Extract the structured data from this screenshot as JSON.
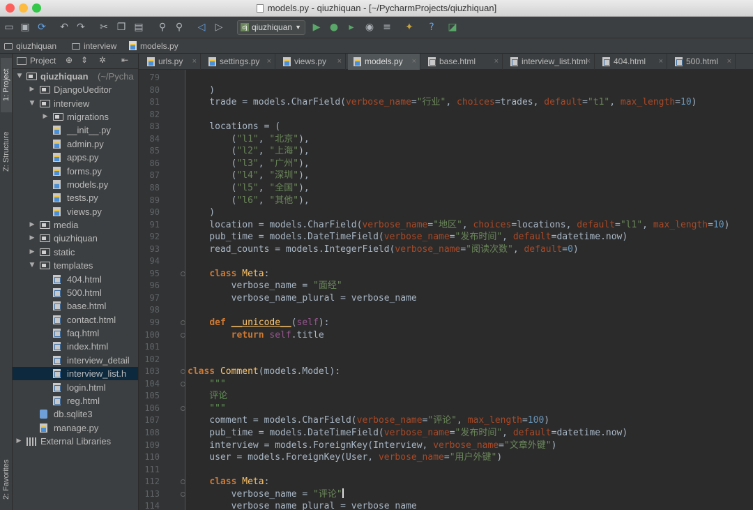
{
  "window": {
    "title": "models.py - qiuzhiquan - [~/PycharmProjects/qiuzhiquan]",
    "traffic_colors": [
      "#fc605c",
      "#fdbc40",
      "#34c84a"
    ]
  },
  "toolbar": {
    "run_config": "qiuzhiquan",
    "icons": [
      "open-folder-icon",
      "save-icon",
      "sync-icon",
      "back-icon",
      "forward-icon",
      "cut-icon",
      "copy-icon",
      "paste-icon",
      "find-icon",
      "replace-icon",
      "nav-back-icon",
      "nav-forward-icon",
      "run-icon",
      "debug-icon",
      "coverage-icon",
      "profile-icon",
      "tasks-icon",
      "settings-icon",
      "help-icon",
      "vcs-icon"
    ]
  },
  "navbar": {
    "crumbs": [
      "qiuzhiquan",
      "interview",
      "models.py"
    ]
  },
  "sidebar": {
    "tabs": [
      "1: Project",
      "Z: Structure",
      "2: Favorites"
    ]
  },
  "project": {
    "header_label": "Project",
    "root_name": "qiuzhiquan",
    "root_path": "(~/Pycha",
    "items": [
      {
        "label": "DjangoUeditor",
        "type": "folder"
      },
      {
        "label": "interview",
        "type": "folder"
      },
      {
        "label": "migrations",
        "type": "folder"
      },
      {
        "label": "__init__.py",
        "type": "py"
      },
      {
        "label": "admin.py",
        "type": "py"
      },
      {
        "label": "apps.py",
        "type": "py"
      },
      {
        "label": "forms.py",
        "type": "py"
      },
      {
        "label": "models.py",
        "type": "py"
      },
      {
        "label": "tests.py",
        "type": "py"
      },
      {
        "label": "views.py",
        "type": "py"
      },
      {
        "label": "media",
        "type": "folder"
      },
      {
        "label": "qiuzhiquan",
        "type": "folder"
      },
      {
        "label": "static",
        "type": "folder"
      },
      {
        "label": "templates",
        "type": "folder"
      },
      {
        "label": "404.html",
        "type": "html"
      },
      {
        "label": "500.html",
        "type": "html"
      },
      {
        "label": "base.html",
        "type": "html"
      },
      {
        "label": "contact.html",
        "type": "html"
      },
      {
        "label": "faq.html",
        "type": "html"
      },
      {
        "label": "index.html",
        "type": "html"
      },
      {
        "label": "interview_detail",
        "type": "html"
      },
      {
        "label": "interview_list.h",
        "type": "html",
        "selected": true
      },
      {
        "label": "login.html",
        "type": "html"
      },
      {
        "label": "reg.html",
        "type": "html"
      },
      {
        "label": "db.sqlite3",
        "type": "db"
      },
      {
        "label": "manage.py",
        "type": "py"
      },
      {
        "label": "External Libraries",
        "type": "lib"
      }
    ]
  },
  "tabs": [
    {
      "label": "urls.py",
      "type": "py"
    },
    {
      "label": "settings.py",
      "type": "py"
    },
    {
      "label": "views.py",
      "type": "py"
    },
    {
      "label": "models.py",
      "type": "py",
      "active": true
    },
    {
      "label": "base.html",
      "type": "html"
    },
    {
      "label": "interview_list.html",
      "type": "html"
    },
    {
      "label": "404.html",
      "type": "html"
    },
    {
      "label": "500.html",
      "type": "html"
    }
  ],
  "editor": {
    "lines": [
      {
        "n": "79",
        "tokens": []
      },
      {
        "n": "80",
        "tokens": [
          [
            "",
            "    )"
          ]
        ]
      },
      {
        "n": "81",
        "tokens": [
          [
            "",
            "    trade = models.CharField("
          ],
          [
            "pn",
            "verbose_name"
          ],
          [
            "",
            "="
          ],
          [
            "st",
            "\"行业\""
          ],
          [
            "",
            ", "
          ],
          [
            "pn",
            "choices"
          ],
          [
            "",
            "=trades, "
          ],
          [
            "pn",
            "default"
          ],
          [
            "",
            "="
          ],
          [
            "st",
            "\"t1\""
          ],
          [
            "",
            ", "
          ],
          [
            "pn",
            "max_length"
          ],
          [
            "",
            "="
          ],
          [
            "nm",
            "10"
          ],
          [
            "",
            ")"
          ]
        ]
      },
      {
        "n": "82",
        "tokens": []
      },
      {
        "n": "83",
        "tokens": [
          [
            "",
            "    locations = ("
          ]
        ]
      },
      {
        "n": "84",
        "tokens": [
          [
            "",
            "        ("
          ],
          [
            "st",
            "\"l1\""
          ],
          [
            "",
            ", "
          ],
          [
            "st",
            "\"北京\""
          ],
          [
            "",
            "),"
          ]
        ]
      },
      {
        "n": "85",
        "tokens": [
          [
            "",
            "        ("
          ],
          [
            "st",
            "\"l2\""
          ],
          [
            "",
            ", "
          ],
          [
            "st",
            "\"上海\""
          ],
          [
            "",
            "),"
          ]
        ]
      },
      {
        "n": "86",
        "tokens": [
          [
            "",
            "        ("
          ],
          [
            "st",
            "\"l3\""
          ],
          [
            "",
            ", "
          ],
          [
            "st",
            "\"广州\""
          ],
          [
            "",
            "),"
          ]
        ]
      },
      {
        "n": "87",
        "tokens": [
          [
            "",
            "        ("
          ],
          [
            "st",
            "\"l4\""
          ],
          [
            "",
            ", "
          ],
          [
            "st",
            "\"深圳\""
          ],
          [
            "",
            "),"
          ]
        ]
      },
      {
        "n": "88",
        "tokens": [
          [
            "",
            "        ("
          ],
          [
            "st",
            "\"l5\""
          ],
          [
            "",
            ", "
          ],
          [
            "st",
            "\"全国\""
          ],
          [
            "",
            "),"
          ]
        ]
      },
      {
        "n": "89",
        "tokens": [
          [
            "",
            "        ("
          ],
          [
            "st",
            "\"l6\""
          ],
          [
            "",
            ", "
          ],
          [
            "st",
            "\"其他\""
          ],
          [
            "",
            "),"
          ]
        ]
      },
      {
        "n": "90",
        "tokens": [
          [
            "",
            "    )"
          ]
        ]
      },
      {
        "n": "91",
        "tokens": [
          [
            "",
            "    location = models.CharField("
          ],
          [
            "pn",
            "verbose_name"
          ],
          [
            "",
            "="
          ],
          [
            "st",
            "\"地区\""
          ],
          [
            "",
            ", "
          ],
          [
            "pn",
            "choices"
          ],
          [
            "",
            "=locations, "
          ],
          [
            "pn",
            "default"
          ],
          [
            "",
            "="
          ],
          [
            "st",
            "\"l1\""
          ],
          [
            "",
            ", "
          ],
          [
            "pn",
            "max_length"
          ],
          [
            "",
            "="
          ],
          [
            "nm",
            "10"
          ],
          [
            "",
            ")"
          ]
        ]
      },
      {
        "n": "92",
        "tokens": [
          [
            "",
            "    pub_time = models.DateTimeField("
          ],
          [
            "pn",
            "verbose_name"
          ],
          [
            "",
            "="
          ],
          [
            "st",
            "\"发布时间\""
          ],
          [
            "",
            ", "
          ],
          [
            "pn",
            "default"
          ],
          [
            "",
            "=datetime.now)"
          ]
        ]
      },
      {
        "n": "93",
        "tokens": [
          [
            "",
            "    read_counts = models.IntegerField("
          ],
          [
            "pn",
            "verbose_name"
          ],
          [
            "",
            "="
          ],
          [
            "st",
            "\"阅读次数\""
          ],
          [
            "",
            ", "
          ],
          [
            "pn",
            "default"
          ],
          [
            "",
            "="
          ],
          [
            "nm",
            "0"
          ],
          [
            "",
            ")"
          ]
        ]
      },
      {
        "n": "94",
        "tokens": []
      },
      {
        "n": "95",
        "tokens": [
          [
            "",
            "    "
          ],
          [
            "kw",
            "class"
          ],
          [
            "",
            " "
          ],
          [
            "cn",
            "Meta"
          ],
          [
            "",
            ":"
          ]
        ]
      },
      {
        "n": "96",
        "tokens": [
          [
            "",
            "        verbose_name = "
          ],
          [
            "st",
            "\"面经\""
          ]
        ]
      },
      {
        "n": "97",
        "tokens": [
          [
            "",
            "        verbose_name_plural = verbose_name"
          ]
        ]
      },
      {
        "n": "98",
        "tokens": []
      },
      {
        "n": "99",
        "tokens": [
          [
            "",
            "    "
          ],
          [
            "kw",
            "def"
          ],
          [
            "",
            " "
          ],
          [
            "fn",
            "__unicode__"
          ],
          [
            "",
            "("
          ],
          [
            "sf",
            "self"
          ],
          [
            "",
            "):"
          ]
        ]
      },
      {
        "n": "100",
        "tokens": [
          [
            "",
            "        "
          ],
          [
            "kw",
            "return"
          ],
          [
            "",
            " "
          ],
          [
            "sf",
            "self"
          ],
          [
            "",
            ".title"
          ]
        ]
      },
      {
        "n": "101",
        "tokens": []
      },
      {
        "n": "102",
        "tokens": []
      },
      {
        "n": "103",
        "tokens": [
          [
            "kw",
            "class"
          ],
          [
            "",
            " "
          ],
          [
            "cn",
            "Comment"
          ],
          [
            "",
            "(models.Model):"
          ]
        ]
      },
      {
        "n": "104",
        "tokens": [
          [
            "cm",
            "    \"\"\""
          ]
        ]
      },
      {
        "n": "105",
        "tokens": [
          [
            "cm",
            "    评论"
          ]
        ]
      },
      {
        "n": "106",
        "tokens": [
          [
            "cm",
            "    \"\"\""
          ]
        ]
      },
      {
        "n": "107",
        "tokens": [
          [
            "",
            "    comment = models.CharField("
          ],
          [
            "pn",
            "verbose_name"
          ],
          [
            "",
            "="
          ],
          [
            "st",
            "\"评论\""
          ],
          [
            "",
            ", "
          ],
          [
            "pn",
            "max_length"
          ],
          [
            "",
            "="
          ],
          [
            "nm",
            "100"
          ],
          [
            "",
            ")"
          ]
        ]
      },
      {
        "n": "108",
        "tokens": [
          [
            "",
            "    pub_time = models.DateTimeField("
          ],
          [
            "pn",
            "verbose_name"
          ],
          [
            "",
            "="
          ],
          [
            "st",
            "\"发布时间\""
          ],
          [
            "",
            ", "
          ],
          [
            "pn",
            "default"
          ],
          [
            "",
            "=datetime.now)"
          ]
        ]
      },
      {
        "n": "109",
        "tokens": [
          [
            "",
            "    interview = models.ForeignKey(Interview, "
          ],
          [
            "pn",
            "verbose_name"
          ],
          [
            "",
            "="
          ],
          [
            "st",
            "\"文章外键\""
          ],
          [
            "",
            ")"
          ]
        ]
      },
      {
        "n": "110",
        "tokens": [
          [
            "",
            "    user = models.ForeignKey(User, "
          ],
          [
            "pn",
            "verbose_name"
          ],
          [
            "",
            "="
          ],
          [
            "st",
            "\"用户外键\""
          ],
          [
            "",
            ")"
          ]
        ]
      },
      {
        "n": "111",
        "tokens": []
      },
      {
        "n": "112",
        "tokens": [
          [
            "",
            "    "
          ],
          [
            "kw",
            "class"
          ],
          [
            "",
            " "
          ],
          [
            "cn",
            "Meta"
          ],
          [
            "",
            ":"
          ]
        ]
      },
      {
        "n": "113",
        "tokens": [
          [
            "",
            "        verbose_name = "
          ],
          [
            "st",
            "\"评论\""
          ],
          [
            "caret",
            ""
          ]
        ]
      },
      {
        "n": "114",
        "tokens": [
          [
            "",
            "        verbose_name_plural = verbose_name"
          ]
        ]
      }
    ]
  }
}
